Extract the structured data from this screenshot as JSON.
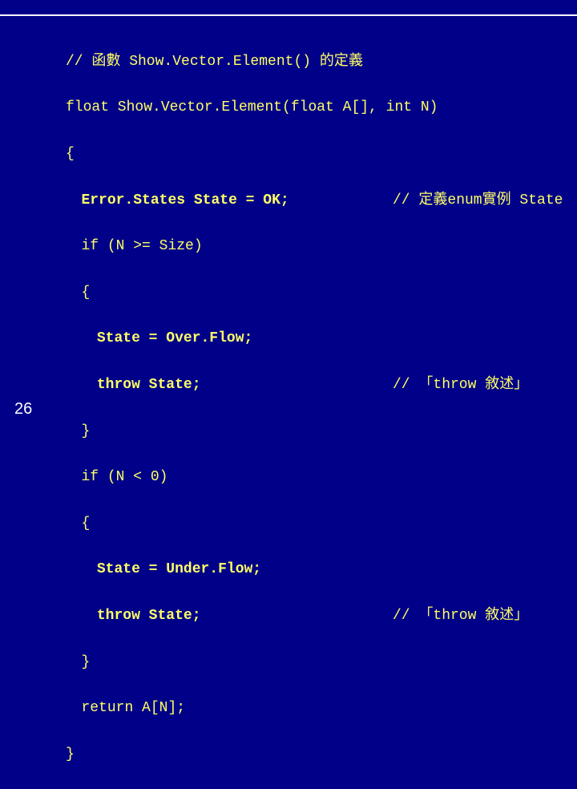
{
  "page_number": "26",
  "code": {
    "l01": "// 函數 Show.Vector.Element() 的定義",
    "l02": "float Show.Vector.Element(float A[], int N)",
    "l03": "{",
    "l04a": "Error.States State = OK;",
    "l04b": "// 定義enum實例 State",
    "l05": "if (N >= Size)",
    "l06": "{",
    "l07": "State = Over.Flow;",
    "l08a": "throw State;",
    "l08b": "// 「throw 敘述」",
    "l09": "}",
    "l10": "if (N < 0)",
    "l11": "{",
    "l12": "State = Under.Flow;",
    "l13a": "throw State;",
    "l13b": "// 「throw 敘述」",
    "l14": "}",
    "l15": "return A[N];",
    "l16": "}"
  }
}
